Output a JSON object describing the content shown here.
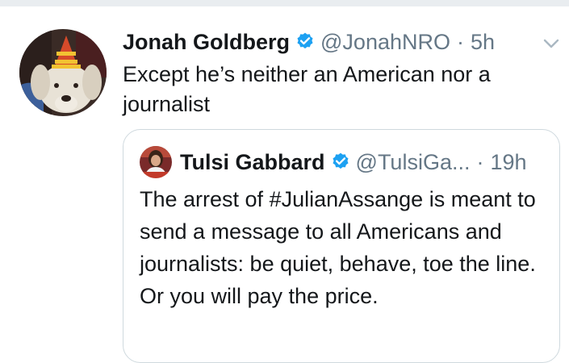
{
  "tweet": {
    "author_name": "Jonah Goldberg",
    "author_handle": "@JonahNRO",
    "separator": "·",
    "time": "5h",
    "text": "Except he’s neither an American nor a journalist",
    "avatar_icon": "dog-party-hat-avatar",
    "menu_icon": "chevron-down-icon"
  },
  "quoted_tweet": {
    "author_name": "Tulsi Gabbard",
    "author_handle": "@TulsiGa...",
    "separator": "·",
    "time": "19h",
    "text": "The arrest of #JulianAssange is meant to send a message to all Americans and journalists: be quiet, behave, toe the line. Or you will pay the price.",
    "avatar_icon": "tulsi-gabbard-avatar"
  },
  "colors": {
    "verified_badge": "#1da1f2",
    "secondary_text": "#657786",
    "primary_text": "#14171a",
    "border": "#cfd9de"
  }
}
